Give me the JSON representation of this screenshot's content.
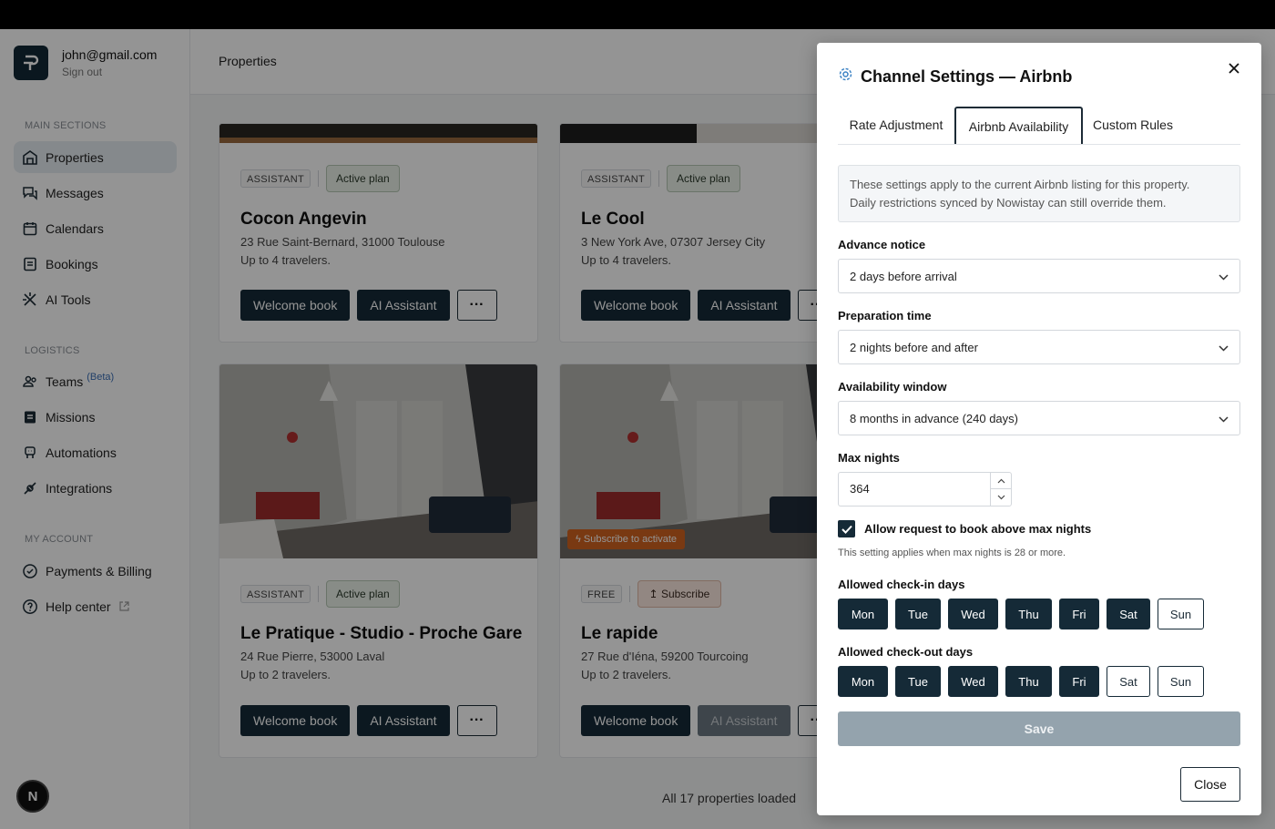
{
  "user": {
    "email": "john@gmail.com",
    "signout": "Sign out"
  },
  "sidebar": {
    "sections": [
      {
        "label": "MAIN SECTIONS"
      },
      {
        "label": "LOGISTICS"
      },
      {
        "label": "MY ACCOUNT"
      }
    ],
    "items": [
      {
        "label": "Properties",
        "icon": "properties-icon",
        "active": true
      },
      {
        "label": "Messages",
        "icon": "messages-icon"
      },
      {
        "label": "Calendars",
        "icon": "calendar-icon"
      },
      {
        "label": "Bookings",
        "icon": "bookings-icon"
      },
      {
        "label": "AI Tools",
        "icon": "ai-tools-icon"
      },
      {
        "label": "Teams",
        "icon": "teams-icon",
        "badge": "(Beta)"
      },
      {
        "label": "Missions",
        "icon": "missions-icon"
      },
      {
        "label": "Automations",
        "icon": "automations-icon"
      },
      {
        "label": "Integrations",
        "icon": "integrations-icon"
      },
      {
        "label": "Payments & Billing",
        "icon": "payments-icon"
      },
      {
        "label": "Help center",
        "icon": "help-icon"
      }
    ],
    "bottom_badge": "N"
  },
  "header": {
    "title": "Properties"
  },
  "cards": [
    {
      "tag": "ASSISTANT",
      "plan": "Active plan",
      "title": "Cocon Angevin",
      "address": "23 Rue Saint-Bernard, 31000 Toulouse",
      "capacity": "Up to 4 travelers."
    },
    {
      "tag": "ASSISTANT",
      "plan": "Active plan",
      "title": "Le Cool",
      "address": "3 New York Ave, 07307 Jersey City",
      "capacity": "Up to 4 travelers."
    },
    {
      "tag": "ASSISTANT",
      "plan": "Active plan",
      "title": "Le Pratique - Studio - Proche Gare",
      "address": "24 Rue Pierre, 53000 Laval",
      "capacity": "Up to 2 travelers."
    },
    {
      "tag": "FREE",
      "plan": "Subscribe",
      "title": "Le rapide",
      "address": "27 Rue d'Iéna, 59200 Tourcoing",
      "capacity": "Up to 2 travelers.",
      "ribbon": "Subscribe to activate"
    }
  ],
  "card_buttons": {
    "welcome": "Welcome book",
    "assistant": "AI Assistant",
    "more": "···"
  },
  "footer": {
    "loaded": "All 17 properties loaded"
  },
  "modal": {
    "title": "Channel Settings — Airbnb",
    "tabs": [
      "Rate Adjustment",
      "Airbnb Availability",
      "Custom Rules"
    ],
    "active_tab": "Airbnb Availability",
    "info_line1": "These settings apply to the current Airbnb listing for this property.",
    "info_line2": "Daily restrictions synced by Nowistay can still override them.",
    "advance_notice": {
      "label": "Advance notice",
      "value": "2 days before arrival"
    },
    "preparation_time": {
      "label": "Preparation time",
      "value": "2 nights before and after"
    },
    "availability_window": {
      "label": "Availability window",
      "value": "8 months in advance (240 days)"
    },
    "max_nights": {
      "label": "Max nights",
      "value": "364"
    },
    "allow_request": {
      "label": "Allow request to book above max nights",
      "checked": true
    },
    "hint": "This setting applies when max nights is 28 or more.",
    "checkin": {
      "label": "Allowed check-in days",
      "days": [
        "Mon",
        "Tue",
        "Wed",
        "Thu",
        "Fri",
        "Sat",
        "Sun"
      ],
      "selected": [
        true,
        true,
        true,
        true,
        true,
        true,
        false
      ]
    },
    "checkout": {
      "label": "Allowed check-out days",
      "days": [
        "Mon",
        "Tue",
        "Wed",
        "Thu",
        "Fri",
        "Sat",
        "Sun"
      ],
      "selected": [
        true,
        true,
        true,
        true,
        true,
        false,
        false
      ]
    },
    "save": "Save",
    "close": "Close"
  },
  "colors": {
    "primary": "#152a37",
    "active_nav": "#e6ecf1",
    "ribbon": "#d06320",
    "save_disabled": "#94a3ad"
  }
}
